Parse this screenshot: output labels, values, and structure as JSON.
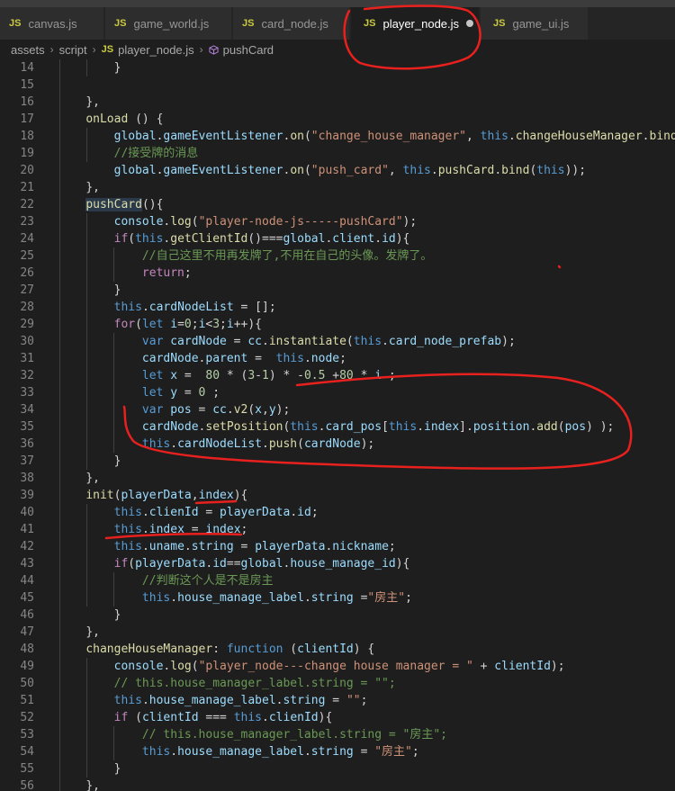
{
  "tabs": [
    {
      "label": "canvas.js",
      "active": false
    },
    {
      "label": "game_world.js",
      "active": false
    },
    {
      "label": "card_node.js",
      "active": false
    },
    {
      "label": "player_node.js",
      "active": true,
      "modified": true
    },
    {
      "label": "game_ui.js",
      "active": false
    }
  ],
  "file_badge": "JS",
  "breadcrumb": {
    "parts": [
      "assets",
      "script"
    ],
    "file": "player_node.js",
    "symbol": "pushCard"
  },
  "line_numbers": [
    "14",
    "15",
    "16",
    "17",
    "18",
    "19",
    "20",
    "21",
    "22",
    "23",
    "24",
    "25",
    "26",
    "27",
    "28",
    "29",
    "30",
    "31",
    "32",
    "33",
    "34",
    "35",
    "36",
    "37",
    "38",
    "39",
    "40",
    "41",
    "42",
    "43",
    "44",
    "45",
    "46",
    "47",
    "48",
    "49",
    "50",
    "51",
    "52",
    "53",
    "54",
    "55",
    "56"
  ],
  "colors": {
    "annotation": "#e8211f",
    "tab_bg": "#2d2d2d",
    "editor_bg": "#1e1e1e"
  }
}
